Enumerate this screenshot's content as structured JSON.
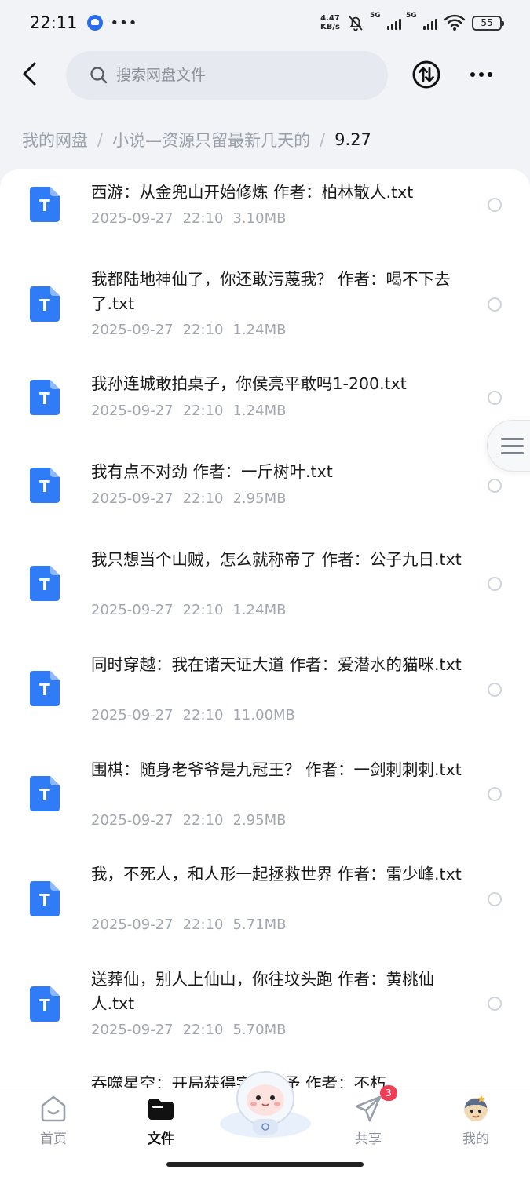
{
  "status_bar": {
    "time": "22:11",
    "net_speed_value": "4.47",
    "net_speed_unit": "KB/s",
    "sim1_label": "5G",
    "sim2_label": "5G",
    "battery": "55"
  },
  "search": {
    "placeholder": "搜索网盘文件"
  },
  "breadcrumb": {
    "items": [
      "我的网盘",
      "小说—资源只留最新几天的"
    ],
    "current": "9.27"
  },
  "files": [
    {
      "name": "西游：从金兜山开始修炼 作者：柏林散人.txt",
      "date": "2025-09-27",
      "time": "22:10",
      "size": "3.10MB"
    },
    {
      "name": "我都陆地神仙了，你还敢污蔑我？ 作者：喝不下去了.txt",
      "date": "2025-09-27",
      "time": "22:10",
      "size": "1.24MB"
    },
    {
      "name": "我孙连城敢拍桌子，你侯亮平敢吗1-200.txt",
      "date": "2025-09-27",
      "time": "22:10",
      "size": "1.24MB"
    },
    {
      "name": "我有点不对劲 作者：一斤树叶.txt",
      "date": "2025-09-27",
      "time": "22:10",
      "size": "2.95MB"
    },
    {
      "name": "我只想当个山贼，怎么就称帝了 作者：公子九日.txt",
      "date": "2025-09-27",
      "time": "22:10",
      "size": "1.24MB"
    },
    {
      "name": "同时穿越：我在诸天证大道 作者：爱潜水的猫咪.txt",
      "date": "2025-09-27",
      "time": "22:10",
      "size": "11.00MB"
    },
    {
      "name": "围棋：随身老爷爷是九冠王？ 作者：一剑刺刺刺.txt",
      "date": "2025-09-27",
      "time": "22:10",
      "size": "2.95MB"
    },
    {
      "name": "我，不死人，和人形一起拯救世界 作者：雷少峰.txt",
      "date": "2025-09-27",
      "time": "22:10",
      "size": "5.71MB"
    },
    {
      "name": "送葬仙，别人上仙山，你往坟头跑 作者：黄桃仙人.txt",
      "date": "2025-09-27",
      "time": "22:10",
      "size": "5.70MB"
    },
    {
      "name": "吞噬星空：开局获得宇宙赐予 作者：不朽",
      "date": "",
      "time": "",
      "size": ""
    }
  ],
  "file_type_letter": "T",
  "tabs": [
    {
      "label": "首页",
      "icon": "home-icon"
    },
    {
      "label": "文件",
      "icon": "folder-icon"
    },
    {
      "label": "共享",
      "icon": "send-icon",
      "badge": "3"
    },
    {
      "label": "我的",
      "icon": "profile-avatar-icon"
    }
  ],
  "colors": {
    "accent": "#2f7cf6",
    "badge": "#f23b55",
    "background": "#f1f3f7"
  }
}
